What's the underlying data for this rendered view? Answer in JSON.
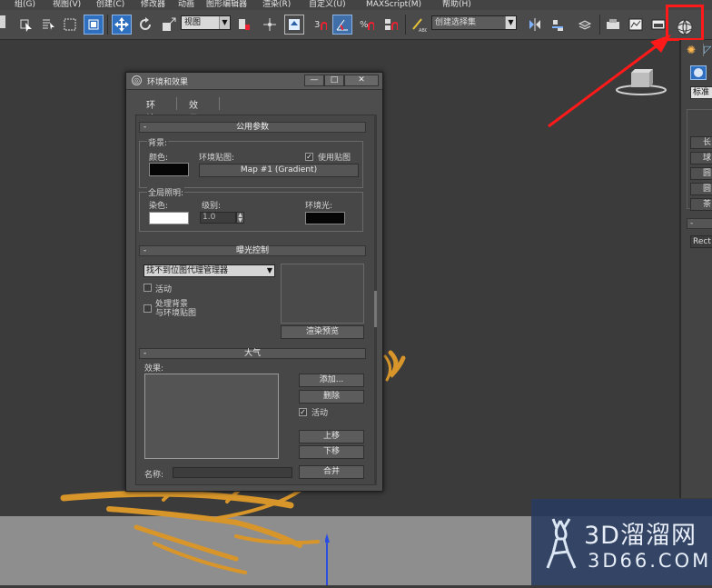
{
  "menubar": {
    "items": [
      "组(G)",
      "视图(V)",
      "创建(C)",
      "修改器",
      "动画",
      "图形编辑器",
      "渲染(R)",
      "自定义(U)",
      "MAXScript(M)",
      "帮助(H)"
    ]
  },
  "toolbar": {
    "view_combo": "视图",
    "selection_set_combo": "创建选择集",
    "icons": [
      "select-icon",
      "select-by-name-icon",
      "rect-region-icon",
      "window-crossing-icon",
      "move-icon",
      "rotate-icon",
      "scale-icon",
      "pivot-icon",
      "manipulate-icon",
      "snap-icon",
      "angle-snap-icon",
      "percent-snap-icon",
      "spinner-snap-icon",
      "named-selection-icon",
      "mirror-icon",
      "align-icon",
      "layer-icon",
      "render-setup-icon",
      "material-editor-icon",
      "render-frame-icon",
      "environment-effects-icon"
    ]
  },
  "command_panel": {
    "tab_buttons": [
      "长",
      "球",
      "圆",
      "圆",
      "茶"
    ],
    "dropdown": "标准基",
    "name_field": "Rect"
  },
  "dialog": {
    "title": "环境和效果",
    "window_buttons": [
      "—",
      "□",
      "✕"
    ],
    "tabs": [
      "环境",
      "效果"
    ],
    "common": {
      "rollout": "公用参数",
      "background_label": "背景:",
      "color_label": "颜色:",
      "env_map_label": "环境贴图:",
      "use_map_label": "使用贴图",
      "use_map_checked": true,
      "map_button": "Map #1 (Gradient)",
      "global_light_label": "全局照明:",
      "tint_label": "染色:",
      "level_label": "级别:",
      "level_value": "1.0",
      "ambient_label": "环境光:"
    },
    "exposure": {
      "rollout": "曝光控制",
      "dropdown": "找不到位图代理管理器",
      "active_label": "活动",
      "process_bg_label_1": "处理背景",
      "process_bg_label_2": "与环境贴图",
      "render_preview_button": "渲染预览"
    },
    "atmosphere": {
      "rollout": "大气",
      "effects_label": "效果:",
      "add_button": "添加...",
      "delete_button": "删除",
      "active_label": "活动",
      "active_checked": true,
      "move_up_button": "上移",
      "move_down_button": "下移",
      "name_label": "名称:",
      "merge_button": "合并"
    }
  },
  "watermark": {
    "brand": "3D溜溜网",
    "domain": "3D66.COM"
  },
  "colors": {
    "highlight": "#ff1a1a",
    "arrow": "#ff1a1a",
    "active_tool": "#2f6fbf",
    "antler": "#d8962a"
  }
}
